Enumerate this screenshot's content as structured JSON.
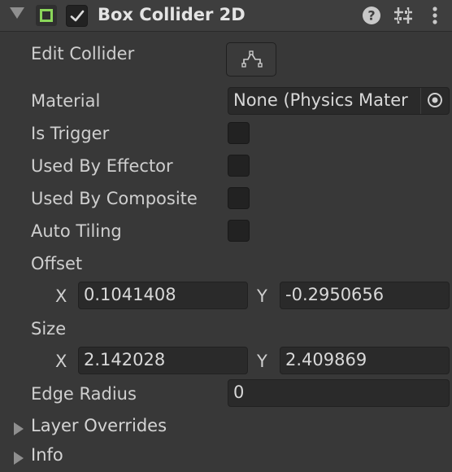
{
  "component": {
    "title": "Box Collider 2D",
    "enabled": true,
    "icon_color": "#8ad65a"
  },
  "header_icons": [
    "help-icon",
    "presets-icon",
    "more-vertical-icon"
  ],
  "fields": {
    "edit_collider": {
      "label": "Edit Collider",
      "icon": "edit-collider-icon"
    },
    "material": {
      "label": "Material",
      "value": "None (Physics Mater",
      "icon": "object-picker-icon"
    },
    "is_trigger": {
      "label": "Is Trigger",
      "checked": false
    },
    "used_by_effector": {
      "label": "Used By Effector",
      "checked": false
    },
    "used_by_composite": {
      "label": "Used By Composite",
      "checked": false
    },
    "auto_tiling": {
      "label": "Auto Tiling",
      "checked": false
    },
    "offset": {
      "label": "Offset",
      "x_label": "X",
      "x": "0.1041408",
      "y_label": "Y",
      "y": "-0.2950656"
    },
    "size": {
      "label": "Size",
      "x_label": "X",
      "x": "2.142028",
      "y_label": "Y",
      "y": "2.409869"
    },
    "edge_radius": {
      "label": "Edge Radius",
      "value": "0"
    }
  },
  "foldouts": {
    "layer_overrides": "Layer Overrides",
    "info": "Info"
  }
}
